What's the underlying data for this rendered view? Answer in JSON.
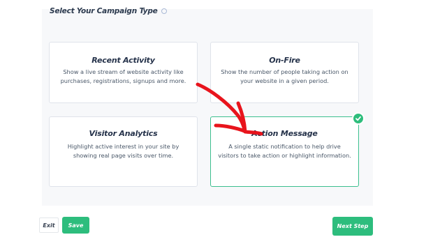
{
  "header": {
    "title": "Select Your Campaign Type"
  },
  "campaign_types": [
    {
      "title": "Recent Activity",
      "description": "Show a live stream of website activity like purchases, registrations, signups and more."
    },
    {
      "title": "On-Fire",
      "description": "Show the number of people taking action on your website in a given period."
    },
    {
      "title": "Visitor Analytics",
      "description": "Highlight active interest in your site by showing real page visits over time."
    },
    {
      "title": "Action Message",
      "description": "A single static notification to help drive visitors to take action or highlight information.",
      "selected": true
    }
  ],
  "footer": {
    "exit_label": "Exit",
    "save_label": "Save",
    "next_label": "Next Step"
  },
  "colors": {
    "accent": "#2dbd7d",
    "annotation": "#e8141c"
  },
  "icons": {
    "info": "info-icon",
    "check": "check-icon",
    "arrow": "annotation-arrow"
  }
}
